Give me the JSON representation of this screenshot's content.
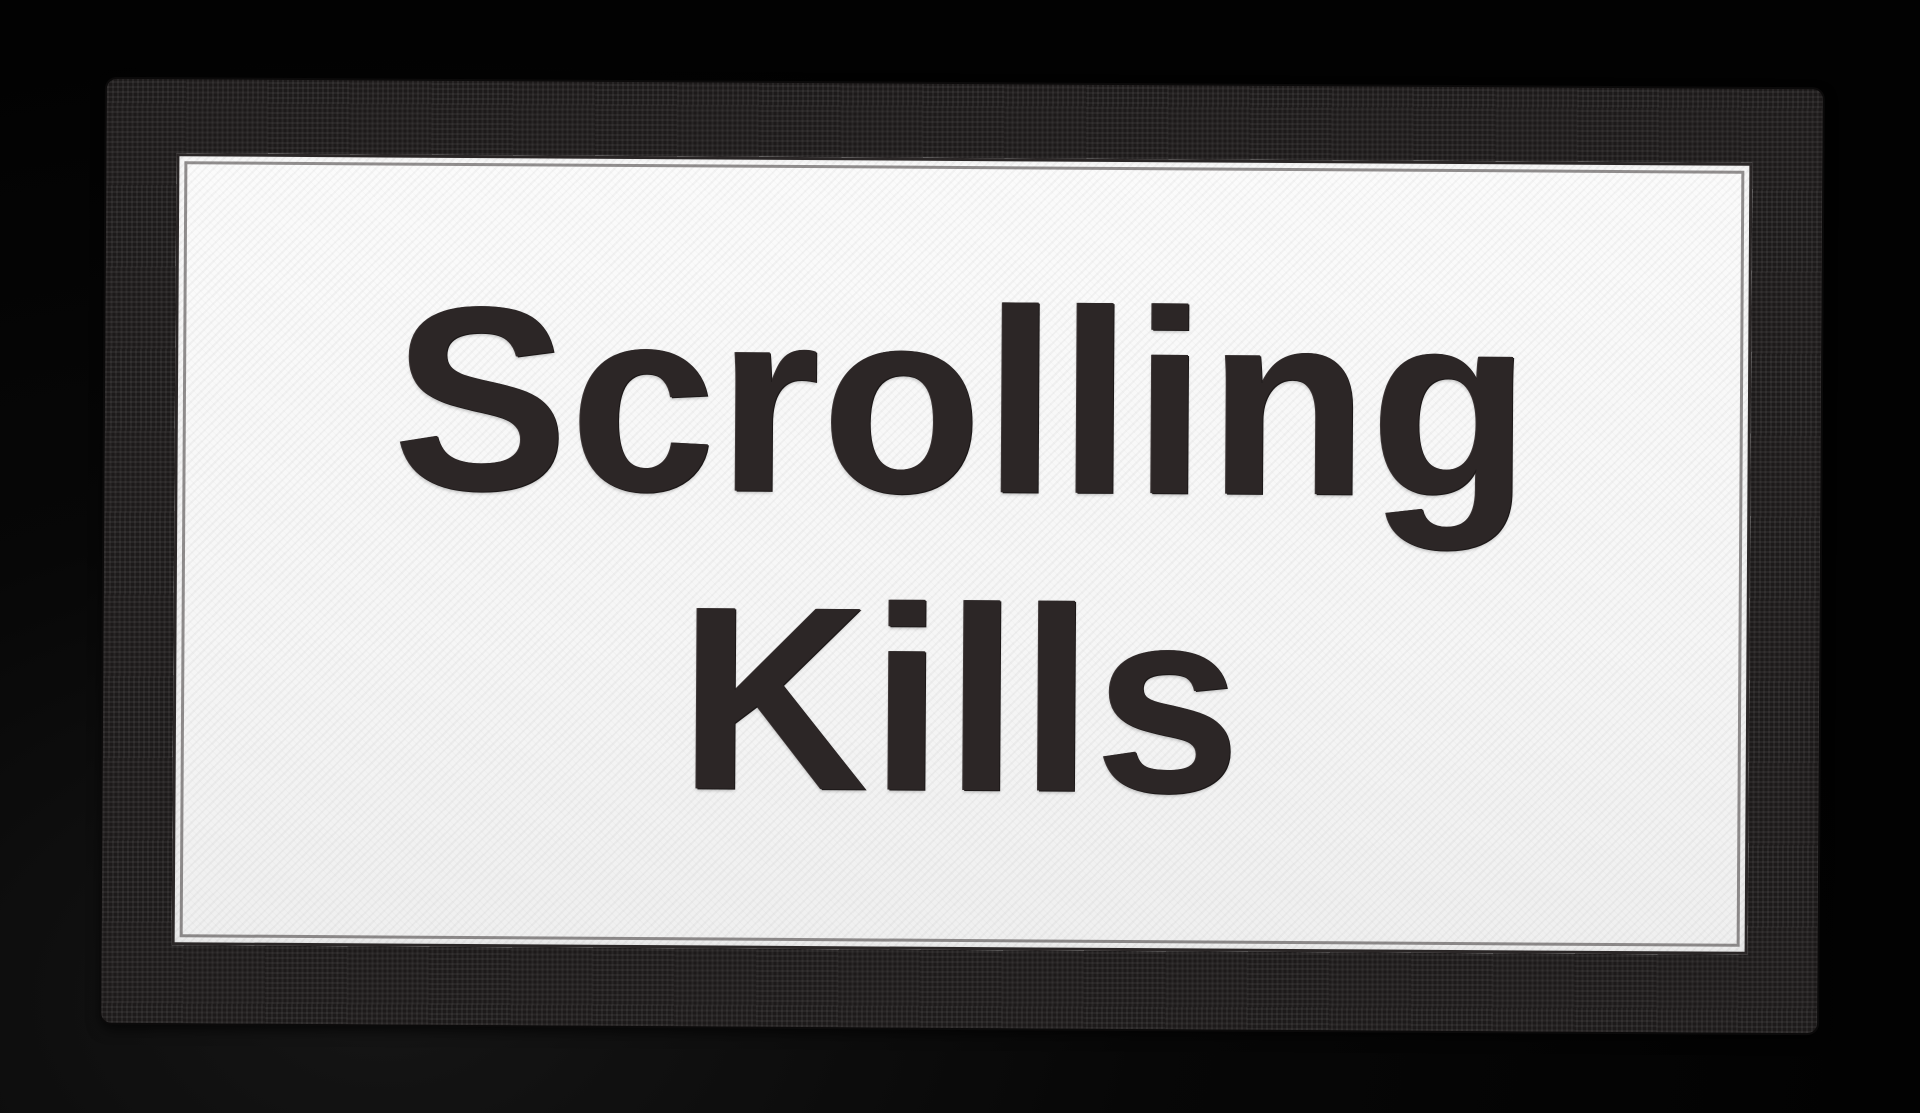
{
  "patch": {
    "line1": "Scrolling",
    "line2": "Kills"
  },
  "colors": {
    "background": "#050505",
    "border": "#1d1a1a",
    "fabric": "#f7f7f7",
    "thread": "#2c2626"
  }
}
